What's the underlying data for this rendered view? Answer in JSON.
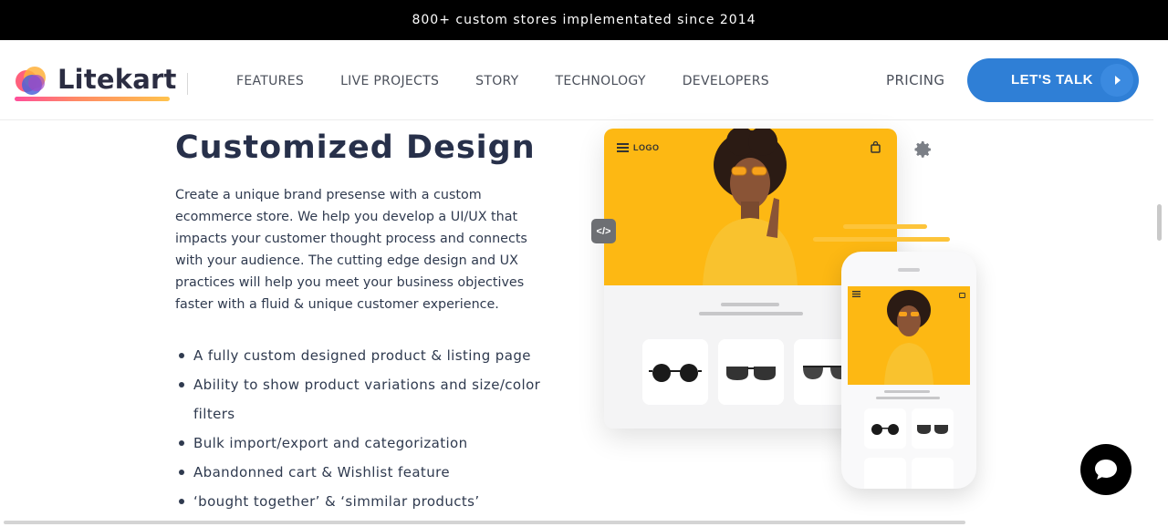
{
  "announcement": "800+ custom stores implementated since 2014",
  "brand": {
    "name": "Litekart"
  },
  "nav": [
    {
      "label": "FEATURES"
    },
    {
      "label": "LIVE PROJECTS"
    },
    {
      "label": "STORY"
    },
    {
      "label": "TECHNOLOGY"
    },
    {
      "label": "DEVELOPERS"
    }
  ],
  "pricing": "PRICING",
  "cta": "LET'S TALK",
  "section": {
    "title": "Customized Design",
    "description": "Create a unique brand presense with a custom ecommerce store. We help you develop a UI/UX that impacts your customer thought process and connects with your audience. The cutting edge design and UX practices will help you meet your business objectives faster with a fluid & unique customer experience.",
    "features": [
      "A fully custom designed product & listing page",
      "Ability to show product variations and size/color filters",
      "Bulk import/export and categorization",
      "Abandonned cart & Wishlist feature",
      "‘bought together’ & ‘simmilar products’"
    ]
  },
  "illustration": {
    "desktop_logo": "LOGO",
    "code_badge": "</>",
    "hero_color": "#fdb813"
  },
  "icons": [
    "menu-icon",
    "bag-icon",
    "gear-icon",
    "code-icon",
    "chat-icon",
    "play-arrow-icon"
  ],
  "colors": {
    "accent": "#2f7fd6",
    "topbar": "#000000",
    "heading": "#27304a"
  }
}
